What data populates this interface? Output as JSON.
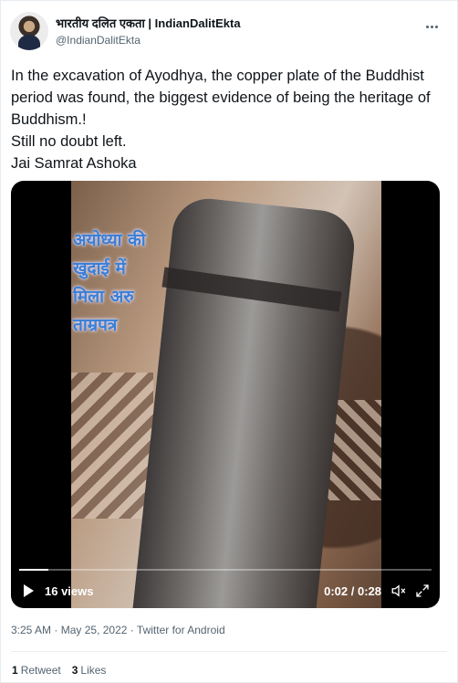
{
  "author": {
    "display_name": "भारतीय दलित एकता | IndianDalitEkta",
    "handle": "@IndianDalitEkta"
  },
  "tweet": {
    "text": "In the excavation of Ayodhya, the copper plate of the Buddhist period was found, the biggest evidence of being the heritage of Buddhism.!\nStill no doubt left.\nJai Samrat Ashoka"
  },
  "video": {
    "overlay_caption": "अयोध्या की\nखुदाई में\nमिला अरु\nताम्रपत्र",
    "views": "16 views",
    "time": "0:02 / 0:28",
    "progress": 0.07,
    "icons": {
      "play": "play-icon",
      "mute": "mute-icon",
      "fullscreen": "fullscreen-icon"
    }
  },
  "meta": {
    "time": "3:25 AM",
    "date": "May 25, 2022",
    "source": "Twitter for Android"
  },
  "stats": {
    "retweets_count": "1",
    "retweets_label": "Retweet",
    "likes_count": "3",
    "likes_label": "Likes"
  },
  "colors": {
    "text_primary": "#0f1419",
    "text_secondary": "#536471",
    "caption_blue": "#3a7fd6"
  }
}
